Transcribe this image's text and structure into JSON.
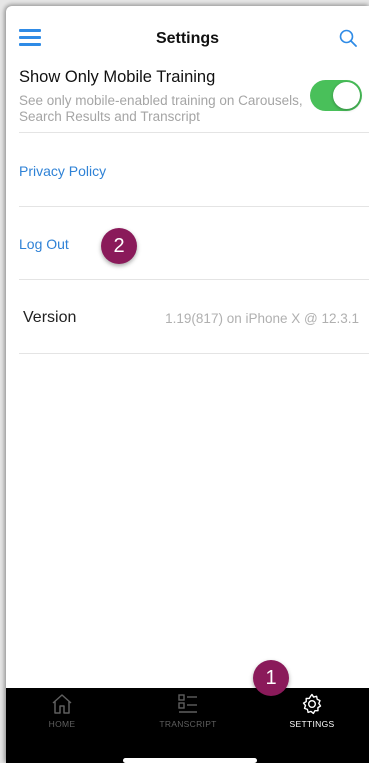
{
  "header": {
    "title": "Settings",
    "menu_icon": "menu-icon",
    "search_icon": "search-icon"
  },
  "settings": {
    "mobile_training": {
      "title": "Show Only Mobile Training",
      "description": "See only mobile-enabled training on Carousels, Search Results and Transcript",
      "enabled": true
    },
    "privacy_policy": "Privacy Policy",
    "log_out": "Log Out",
    "version_label": "Version",
    "version_value": "1.19(817) on iPhone X @ 12.3.1"
  },
  "annotations": {
    "badge_1": "1",
    "badge_2": "2",
    "badge_color": "#8a1a5a"
  },
  "tabbar": {
    "items": [
      {
        "label": "HOME",
        "icon": "home-icon",
        "active": false
      },
      {
        "label": "TRANSCRIPT",
        "icon": "transcript-icon",
        "active": false
      },
      {
        "label": "SETTINGS",
        "icon": "gear-icon",
        "active": true
      }
    ]
  },
  "colors": {
    "accent": "#2f82d6",
    "toggle_on": "#49c05a",
    "tabbar_bg": "#000000"
  }
}
